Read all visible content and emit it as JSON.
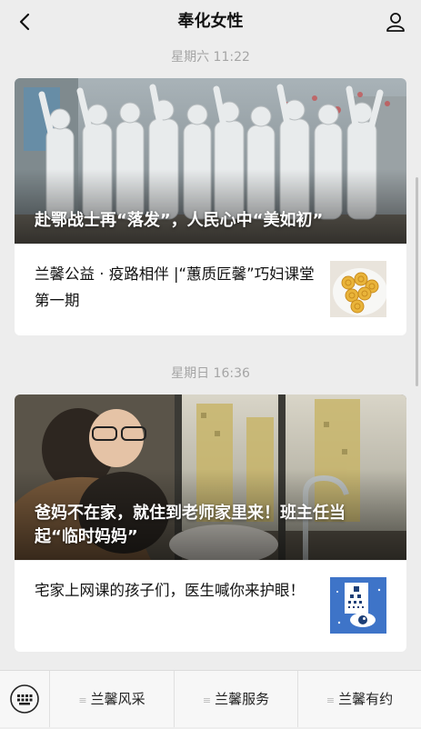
{
  "header": {
    "title": "奉化女性",
    "back_icon": "chevron-left-icon",
    "profile_icon": "user-icon"
  },
  "messages": [
    {
      "time": "星期六 11:22",
      "main_title": "赴鄂战士再“落发”，人民心中“美如初”",
      "sub_title": "兰馨公益 · 疫路相伴 |“蕙质匠馨”巧妇课堂第一期"
    },
    {
      "time": "星期日 16:36",
      "main_title": "爸妈不在家，就住到老师家里来！班主任当起“临时妈妈”",
      "sub_title": "宅家上网课的孩子们，医生喊你来护眼！"
    }
  ],
  "bottom_menu": {
    "keyboard_icon": "keyboard-icon",
    "items": [
      "兰馨风采",
      "兰馨服务",
      "兰馨有约"
    ],
    "item_marker": "≡"
  },
  "colors": {
    "background": "#ededed",
    "card": "#ffffff",
    "timestamp": "#a5a5a5"
  }
}
